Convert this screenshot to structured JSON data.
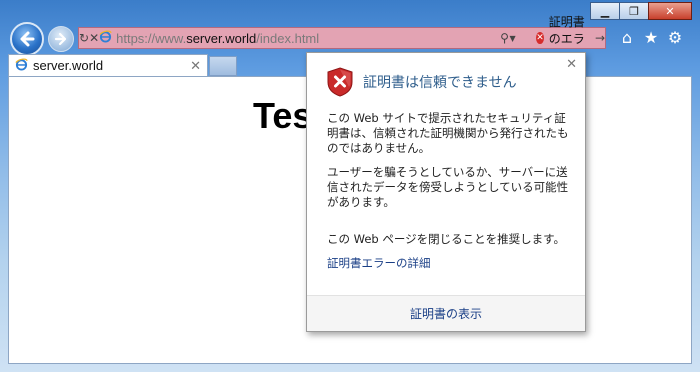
{
  "window": {
    "controls": {
      "minimize": "▁",
      "maximize": "❐",
      "close": "✕"
    }
  },
  "nav": {
    "back_icon": "back-arrow-icon",
    "forward_icon": "forward-arrow-icon"
  },
  "address_bar": {
    "url_prefix": "https://www.",
    "url_host": "server.world",
    "url_path": "/index.html",
    "cert_error_label": "証明書のエラー",
    "bg_color": "#e3a3b3"
  },
  "tab": {
    "label": "server.world"
  },
  "page": {
    "heading": "Tes"
  },
  "popup": {
    "title": "証明書は信頼できません",
    "paragraphs": [
      "この Web サイトで提示されたセキュリティ証明書は、信頼された証明機関から発行されたものではありません。",
      "ユーザーを騙そうとしているか、サーバーに送信されたデータを傍受しようとしている可能性があります。",
      "この Web ページを閉じることを推奨します。"
    ],
    "details_link": "証明書エラーの詳細",
    "footer_link": "証明書の表示"
  }
}
